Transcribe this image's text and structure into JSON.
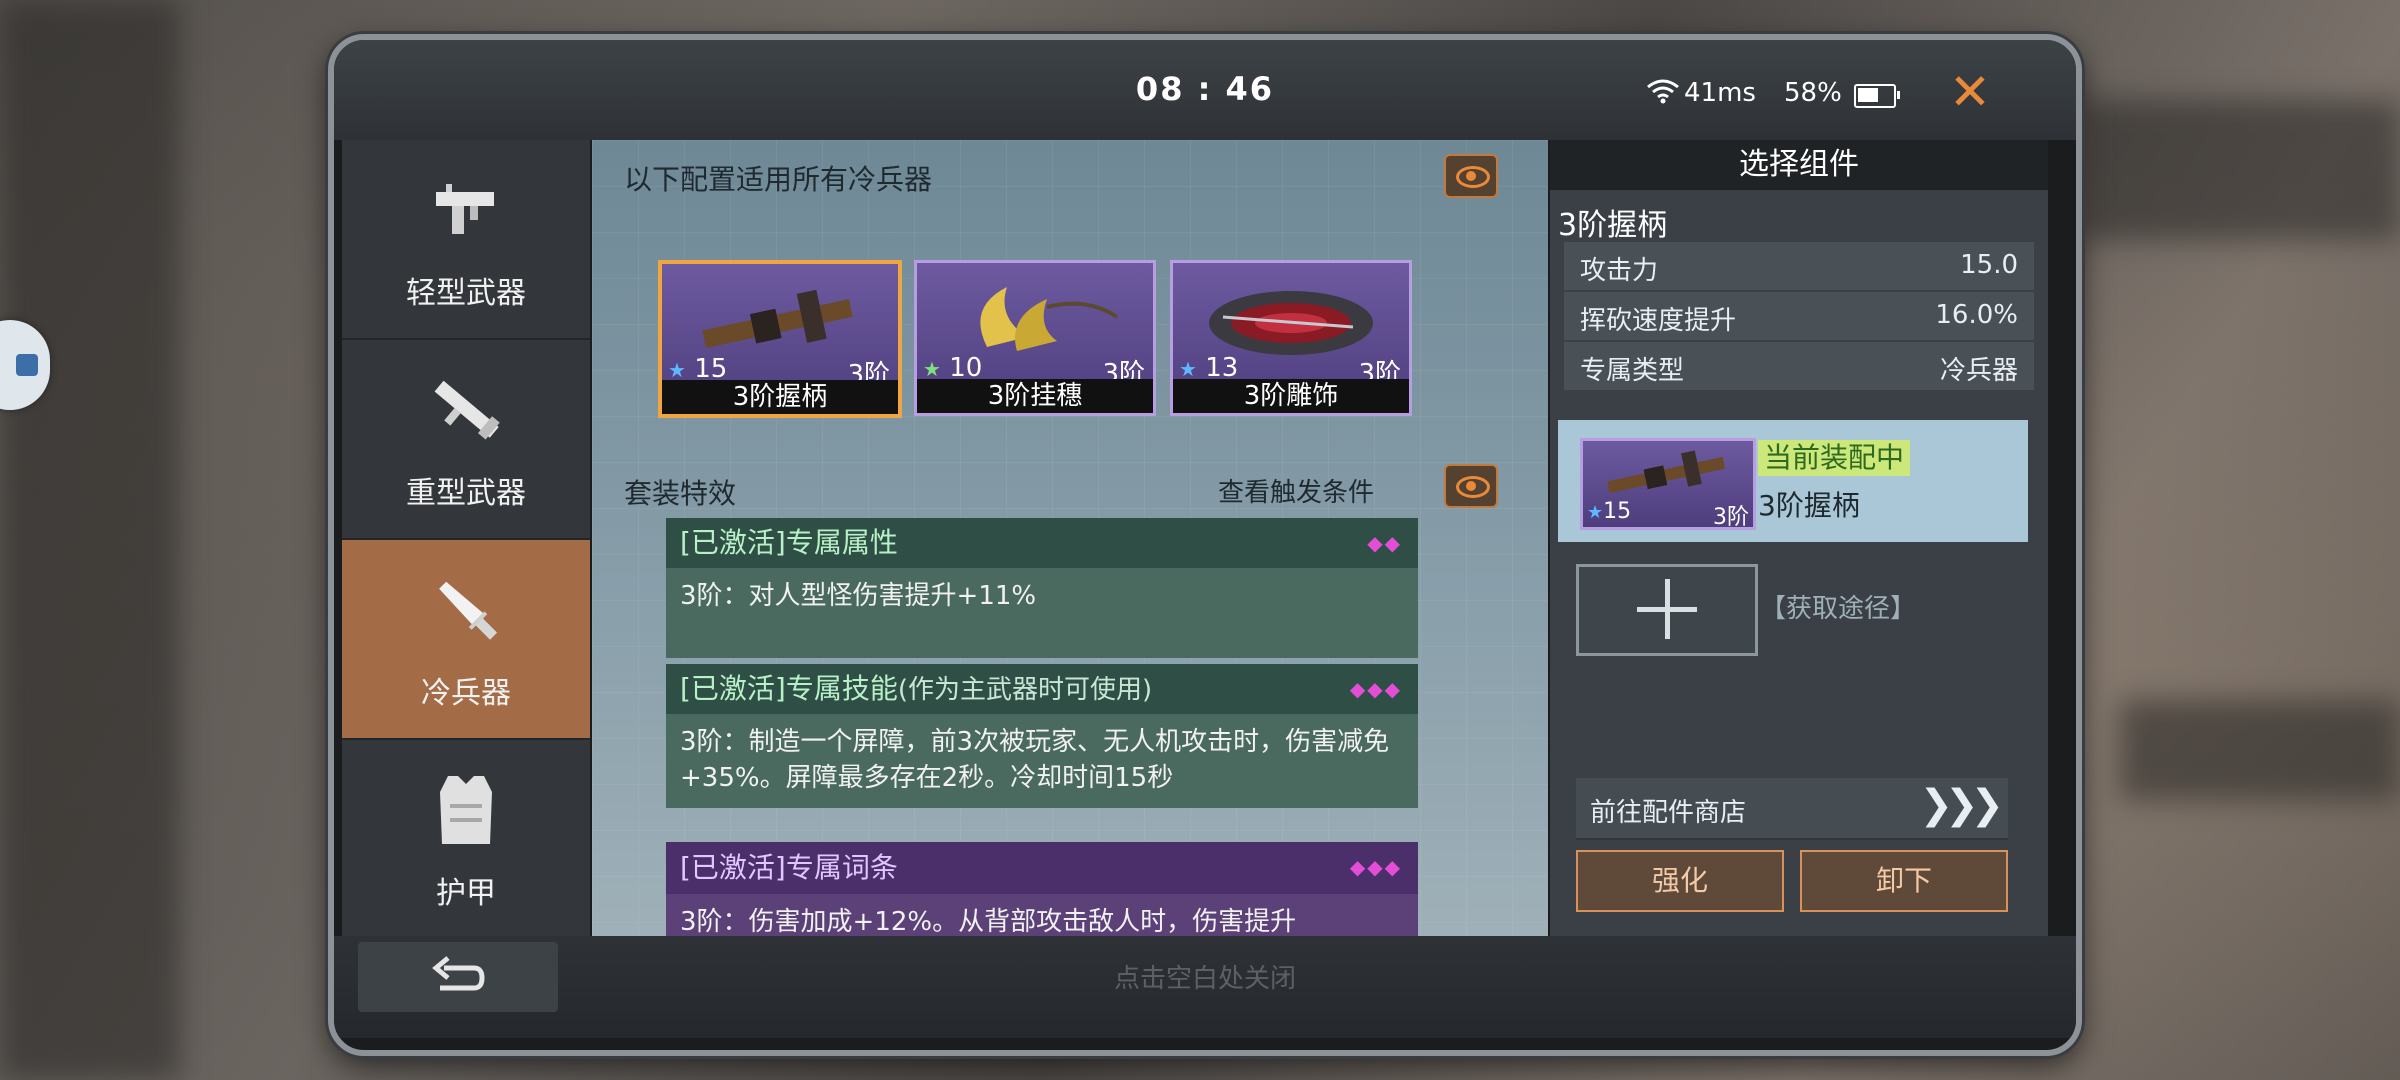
{
  "status": {
    "time": "08 : 46",
    "ping": "41ms",
    "battery": "58%",
    "battery_level": 0.58
  },
  "nav": {
    "items": [
      {
        "label": "轻型武器",
        "icon": "smg-icon"
      },
      {
        "label": "重型武器",
        "icon": "rocket-launcher-icon"
      },
      {
        "label": "冷兵器",
        "icon": "knife-icon",
        "active": true
      },
      {
        "label": "护甲",
        "icon": "armor-vest-icon"
      }
    ]
  },
  "main": {
    "config_title": "以下配置适用所有冷兵器",
    "parts": [
      {
        "stars": "15",
        "tier": "3阶",
        "name": "3阶握柄",
        "star_color": "#5fb8ff",
        "selected": true
      },
      {
        "stars": "10",
        "tier": "3阶",
        "name": "3阶挂穗",
        "star_color": "#7fe07f"
      },
      {
        "stars": "13",
        "tier": "3阶",
        "name": "3阶雕饰",
        "star_color": "#5fb8ff"
      }
    ],
    "set_title": "套装特效",
    "trigger_label": "查看触发条件",
    "effects": [
      {
        "title": "[已激活]专属属性",
        "dots": "◆◆",
        "text": "3阶：对人型怪伤害提升+11%"
      },
      {
        "title": "[已激活]专属技能",
        "title_note": "(作为主武器时可使用)",
        "dots": "◆◆◆",
        "text": "3阶：制造一个屏障，前3次被玩家、无人机攻击时，伤害减免+35%。屏障最多存在2秒。冷却时间15秒"
      },
      {
        "title": "[已激活]专属词条",
        "dots": "◆◆◆",
        "text": "3阶：伤害加成+12%。从背部攻击敌人时，伤害提升"
      }
    ]
  },
  "right": {
    "title": "选择组件",
    "part_name": "3阶握柄",
    "stats": [
      {
        "label": "攻击力",
        "value": "15.0"
      },
      {
        "label": "挥砍速度提升",
        "value": "16.0%"
      },
      {
        "label": "专属类型",
        "value": "冷兵器"
      }
    ],
    "equipped_badge": "当前装配中",
    "equipped_name": "3阶握柄",
    "equipped_stars": "15",
    "equipped_tier": "3阶",
    "get_path": "【获取途径】",
    "shop_label": "前往配件商店",
    "shop_chevrons": "❯❯❯",
    "enhance_label": "强化",
    "unequip_label": "卸下"
  },
  "footer": {
    "close_hint": "点击空白处关闭"
  },
  "colors": {
    "accent": "#e98a3a",
    "active_tab": "#a46b47",
    "purple_rarity": "#6d5aa0"
  }
}
